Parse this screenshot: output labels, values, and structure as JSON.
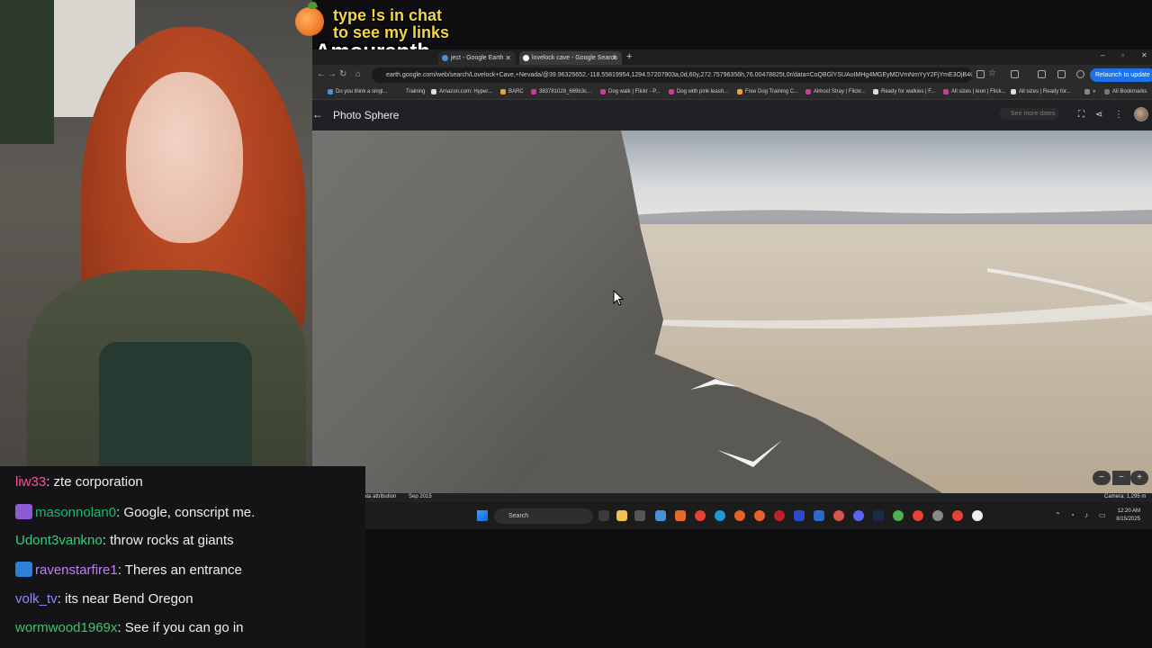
{
  "overlay": {
    "promo_line1": "type !s in chat",
    "promo_line2": "to see my links",
    "streamer_name": "Amouranth"
  },
  "browser": {
    "tabs": [
      {
        "label": "ject - Google Earth",
        "favicon_color": "#4a90d9"
      },
      {
        "label": "lovelock cave - Google Search",
        "favicon_color": "#ffffff"
      }
    ],
    "new_tab": "+",
    "window_controls": [
      "–",
      "▫",
      "✕"
    ],
    "url": "earth.google.com/web/search/Lovelock+Cave,+Nevada/@39.96325652,-118.55819954,1294.57207903a,0d,60y,272.75796356h,76.00478825t,0r/data=CoQBGlYSUAoIMHg4MGEyMDVmNmYyY2FjYmE3OjB4OGI5",
    "relaunch_label": "Relaunch to update",
    "bookmarks": [
      {
        "label": "Do you think a singl...",
        "color": "#4a90d9"
      },
      {
        "label": "Training",
        "color": "#2b2b2b"
      },
      {
        "label": "Amazon.com: Hyper...",
        "color": "#dddddd"
      },
      {
        "label": "BARC",
        "color": "#e8a33c"
      },
      {
        "label": "383781028_669b3c...",
        "color": "#c83c9a"
      },
      {
        "label": "Dog walk | Flickr - P...",
        "color": "#c83c9a"
      },
      {
        "label": "Dog with pink leash...",
        "color": "#c83c9a"
      },
      {
        "label": "Free Dog Training C...",
        "color": "#e8a33c"
      },
      {
        "label": "Almost Stray | Flickr...",
        "color": "#c83c9a"
      },
      {
        "label": "Ready for walkies | F...",
        "color": "#dddddd"
      },
      {
        "label": "All sizes | leon | Flick...",
        "color": "#c83c9a"
      },
      {
        "label": "All sizes | Ready for...",
        "color": "#dddddd"
      }
    ],
    "all_bookmarks": "All Bookmarks"
  },
  "earth": {
    "title": "Photo Sphere",
    "see_more_dates": "See more dates",
    "data_attribution": "ata attribution",
    "capture_date": "Sep 2015",
    "camera": "Camera: 1,295 m"
  },
  "taskbar": {
    "search_placeholder": "Search",
    "time": "12:20 AM",
    "date": "8/15/2025"
  },
  "chat": [
    {
      "user": "liw33",
      "message": "zte corporation",
      "color": "#ff4f9a",
      "badge": null
    },
    {
      "user": "masonnolan0",
      "message": "Google, conscript me.",
      "color": "#0ebf6c",
      "badge": "#8b5bd6"
    },
    {
      "user": "Udont3vankno",
      "message": "throw rocks at giants",
      "color": "#31d17e",
      "badge": null
    },
    {
      "user": "ravenstarfire1",
      "message": "Theres an entrance",
      "color": "#c67bff",
      "badge": "#2e7fd6"
    },
    {
      "user": "volk_tv",
      "message": "its near Bend Oregon",
      "color": "#8b8bff",
      "badge": null
    },
    {
      "user": "wormwood1969x",
      "message": "See if you can go in",
      "color": "#3ec46a",
      "badge": null
    }
  ]
}
